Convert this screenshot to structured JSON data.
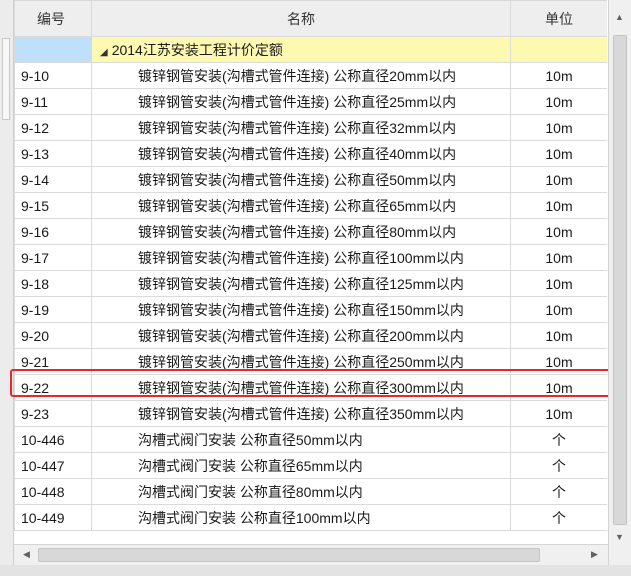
{
  "table": {
    "headers": {
      "code": "编号",
      "name": "名称",
      "unit": "单位"
    },
    "group": {
      "label": "2014江苏安装工程计价定额",
      "expander": "◢"
    },
    "rows": [
      {
        "code": "9-10",
        "name": "镀锌钢管安装(沟槽式管件连接) 公称直径20mm以内",
        "unit": "10m"
      },
      {
        "code": "9-11",
        "name": "镀锌钢管安装(沟槽式管件连接) 公称直径25mm以内",
        "unit": "10m"
      },
      {
        "code": "9-12",
        "name": "镀锌钢管安装(沟槽式管件连接) 公称直径32mm以内",
        "unit": "10m"
      },
      {
        "code": "9-13",
        "name": "镀锌钢管安装(沟槽式管件连接) 公称直径40mm以内",
        "unit": "10m"
      },
      {
        "code": "9-14",
        "name": "镀锌钢管安装(沟槽式管件连接) 公称直径50mm以内",
        "unit": "10m"
      },
      {
        "code": "9-15",
        "name": "镀锌钢管安装(沟槽式管件连接) 公称直径65mm以内",
        "unit": "10m"
      },
      {
        "code": "9-16",
        "name": "镀锌钢管安装(沟槽式管件连接) 公称直径80mm以内",
        "unit": "10m"
      },
      {
        "code": "9-17",
        "name": "镀锌钢管安装(沟槽式管件连接) 公称直径100mm以内",
        "unit": "10m"
      },
      {
        "code": "9-18",
        "name": "镀锌钢管安装(沟槽式管件连接) 公称直径125mm以内",
        "unit": "10m"
      },
      {
        "code": "9-19",
        "name": "镀锌钢管安装(沟槽式管件连接) 公称直径150mm以内",
        "unit": "10m"
      },
      {
        "code": "9-20",
        "name": "镀锌钢管安装(沟槽式管件连接) 公称直径200mm以内",
        "unit": "10m"
      },
      {
        "code": "9-21",
        "name": "镀锌钢管安装(沟槽式管件连接) 公称直径250mm以内",
        "unit": "10m"
      },
      {
        "code": "9-22",
        "name": "镀锌钢管安装(沟槽式管件连接) 公称直径300mm以内",
        "unit": "10m"
      },
      {
        "code": "9-23",
        "name": "镀锌钢管安装(沟槽式管件连接) 公称直径350mm以内",
        "unit": "10m"
      },
      {
        "code": "10-446",
        "name": "沟槽式阀门安装 公称直径50mm以内",
        "unit": "个"
      },
      {
        "code": "10-447",
        "name": "沟槽式阀门安装 公称直径65mm以内",
        "unit": "个"
      },
      {
        "code": "10-448",
        "name": "沟槽式阀门安装 公称直径80mm以内",
        "unit": "个"
      },
      {
        "code": "10-449",
        "name": "沟槽式阀门安装 公称直径100mm以内",
        "unit": "个"
      }
    ]
  },
  "highlight_color": "#e8262b",
  "scrollbar": {
    "up_arrow": "▲",
    "down_arrow": "▼",
    "left_arrow": "◀",
    "right_arrow": "▶"
  }
}
